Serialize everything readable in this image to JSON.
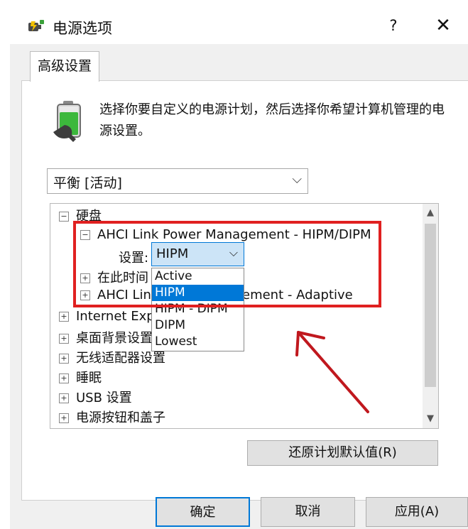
{
  "window": {
    "title": "电源选项",
    "help": "?",
    "close": "✕"
  },
  "tabs": [
    {
      "label": "高级设置"
    }
  ],
  "description": "选择你要自定义的电源计划，然后选择你希望计算机管理的电源设置。",
  "plan": {
    "selected": "平衡 [活动]"
  },
  "tree": {
    "hard_disk": "硬盘",
    "ahci_hipm": "AHCI Link Power Management - HIPM/DIPM",
    "setting_label": "设置:",
    "setting_value": "HIPM",
    "after_time": "在此时间",
    "ahci_adaptive_a": "AHCI Lin",
    "ahci_adaptive_b": "ement - Adaptive",
    "internet": "Internet Expl",
    "desktop": "桌面背景设置",
    "wireless": "无线适配器设置",
    "sleep": "睡眠",
    "usb": "USB 设置",
    "power_buttons": "电源按钮和盖子"
  },
  "dropdown_options": [
    "Active",
    "HIPM",
    "HIPM - DIPM",
    "DIPM",
    "Lowest"
  ],
  "dropdown_selected_index": 1,
  "buttons": {
    "restore": "还原计划默认值(R)",
    "ok": "确定",
    "cancel": "取消",
    "apply": "应用(A)"
  },
  "colors": {
    "highlight": "#e02020",
    "accent": "#0078d7",
    "annotation_arrow": "#c0181e"
  }
}
